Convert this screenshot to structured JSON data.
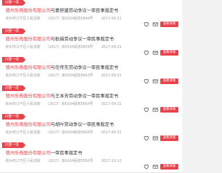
{
  "colors": {
    "accent": "#e8424a",
    "text": "#333333",
    "muted": "#999999"
  },
  "items": [
    {
      "tag": "只要一项",
      "company": "德州乐奇股份有限公司",
      "suffix": "与蒙舒建劳动争议一审民事裁定书",
      "court": "杭州市江干区人民法院",
      "case_no": "（2017）浙0104民初5644号",
      "date": "2017-09-21",
      "button": "查看详情"
    },
    {
      "tag": "只要一项",
      "company": "德州乐奇股份有限公司",
      "suffix": "与耿娟劳动争议一审民事裁定书",
      "court": "杭州市江干区人民法院",
      "case_no": "（2017）浙0104民初5659号",
      "date": "2017-09-21",
      "button": "查看详情"
    },
    {
      "tag": "只要一项",
      "company": "德州乐奇股份有限公司",
      "suffix": "与任传东劳动争议一审民事裁定书",
      "court": "杭州市江干区人民法院",
      "case_no": "（2017）浙0104民初5643号",
      "date": "2017-09-21",
      "button": "查看详情"
    },
    {
      "tag": "只要一项",
      "company": "德州乐奇股份有限公司",
      "suffix": "与王本芳劳动争议一审民事裁定书",
      "court": "杭州市江干区人民法院",
      "case_no": "（2017）浙0104民初5654号",
      "date": "2017-09-21",
      "button": "查看详情"
    },
    {
      "tag": "只要一项",
      "company": "德州乐奇股份有限公司",
      "suffix": "与胡叶劳动争议一审民事裁定书",
      "court": "杭州市江干区人民法院",
      "case_no": "（2017）浙0104民初5664号",
      "date": "2017-09-21",
      "button": "查看详情"
    },
    {
      "tag": "只要一项",
      "company": "德州乐奇股份有限公司",
      "suffix": "一审民事裁定书",
      "court": "杭州市江干区人民法院",
      "case_no": "（2017）浙0104民初5556号",
      "date": "2017-10-12",
      "button": "查看详情"
    }
  ]
}
